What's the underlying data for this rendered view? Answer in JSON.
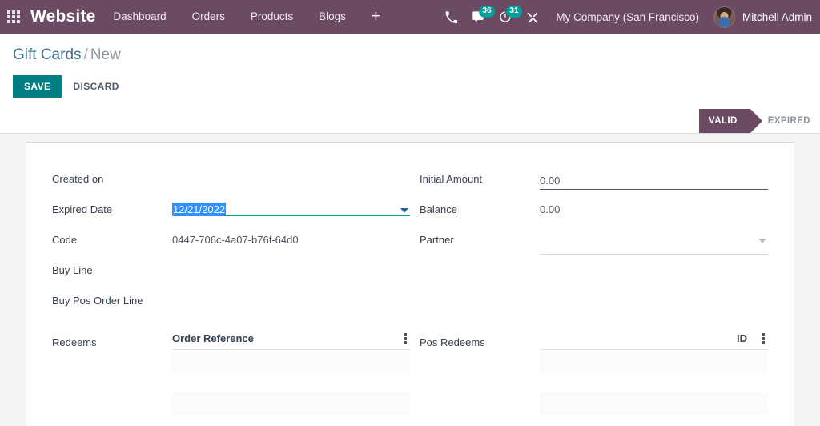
{
  "navbar": {
    "apps_icon": "apps-grid-icon",
    "brand": "Website",
    "menu": [
      {
        "label": "Dashboard"
      },
      {
        "label": "Orders"
      },
      {
        "label": "Products"
      },
      {
        "label": "Blogs"
      }
    ],
    "plus_label": "+",
    "icons": [
      {
        "name": "phone-icon",
        "badge": null
      },
      {
        "name": "messages-icon",
        "badge": "36"
      },
      {
        "name": "activities-clock-icon",
        "badge": "31"
      },
      {
        "name": "debug-tools-icon",
        "badge": null
      }
    ],
    "company": "My Company (San Francisco)",
    "user": "Mitchell Admin"
  },
  "control_panel": {
    "breadcrumb_root": "Gift Cards",
    "breadcrumb_sep": "/",
    "breadcrumb_current": "New",
    "save_label": "SAVE",
    "discard_label": "DISCARD",
    "statuses": [
      {
        "label": "VALID",
        "active": true
      },
      {
        "label": "EXPIRED",
        "active": false
      }
    ]
  },
  "form": {
    "left": {
      "created_on_label": "Created on",
      "created_on_value": "",
      "expired_date_label": "Expired Date",
      "expired_date_value": "12/21/2022",
      "code_label": "Code",
      "code_value": "0447-706c-4a07-b76f-64d0",
      "buy_line_label": "Buy Line",
      "buy_line_value": "",
      "buy_pos_order_line_label": "Buy Pos Order Line",
      "buy_pos_order_line_value": "",
      "redeems_label": "Redeems"
    },
    "right": {
      "initial_amount_label": "Initial Amount",
      "initial_amount_value": "0.00",
      "balance_label": "Balance",
      "balance_value": "0.00",
      "partner_label": "Partner",
      "partner_value": "",
      "pos_redeems_label": "Pos Redeems"
    },
    "redeems_table": {
      "column_header": "Order Reference",
      "rows": [
        "",
        ""
      ]
    },
    "pos_redeems_table": {
      "column_header": "ID",
      "rows": [
        "",
        ""
      ]
    }
  },
  "colors": {
    "navbar": "#6b4b63",
    "accent_teal": "#017e84",
    "badge_teal": "#00a19c",
    "selection_blue": "#3390ff",
    "body_bg": "#f3f4f6"
  }
}
